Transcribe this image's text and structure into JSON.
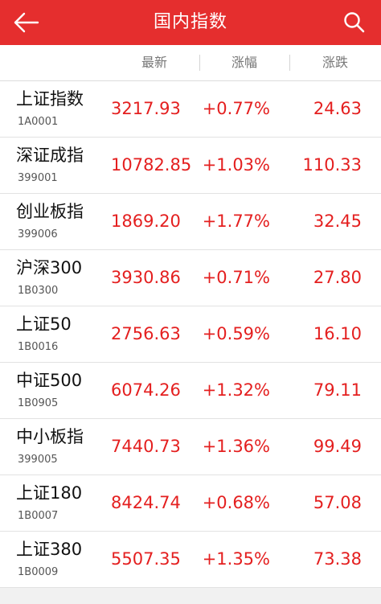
{
  "header": {
    "title": "国内指数",
    "back_icon": "arrow-left-icon",
    "search_icon": "search-icon",
    "bg_color": "#e52e2e"
  },
  "columns": {
    "latest": "最新",
    "pct": "涨幅",
    "chg": "涨跌"
  },
  "rise_color": "#e41f1f",
  "indices": [
    {
      "name": "上证指数",
      "code": "1A0001",
      "latest": "3217.93",
      "pct": "+0.77%",
      "chg": "24.63"
    },
    {
      "name": "深证成指",
      "code": "399001",
      "latest": "10782.85",
      "pct": "+1.03%",
      "chg": "110.33"
    },
    {
      "name": "创业板指",
      "code": "399006",
      "latest": "1869.20",
      "pct": "+1.77%",
      "chg": "32.45"
    },
    {
      "name": "沪深300",
      "code": "1B0300",
      "latest": "3930.86",
      "pct": "+0.71%",
      "chg": "27.80"
    },
    {
      "name": "上证50",
      "code": "1B0016",
      "latest": "2756.63",
      "pct": "+0.59%",
      "chg": "16.10"
    },
    {
      "name": "中证500",
      "code": "1B0905",
      "latest": "6074.26",
      "pct": "+1.32%",
      "chg": "79.11"
    },
    {
      "name": "中小板指",
      "code": "399005",
      "latest": "7440.73",
      "pct": "+1.36%",
      "chg": "99.49"
    },
    {
      "name": "上证180",
      "code": "1B0007",
      "latest": "8424.74",
      "pct": "+0.68%",
      "chg": "57.08"
    },
    {
      "name": "上证380",
      "code": "1B0009",
      "latest": "5507.35",
      "pct": "+1.35%",
      "chg": "73.38"
    }
  ]
}
